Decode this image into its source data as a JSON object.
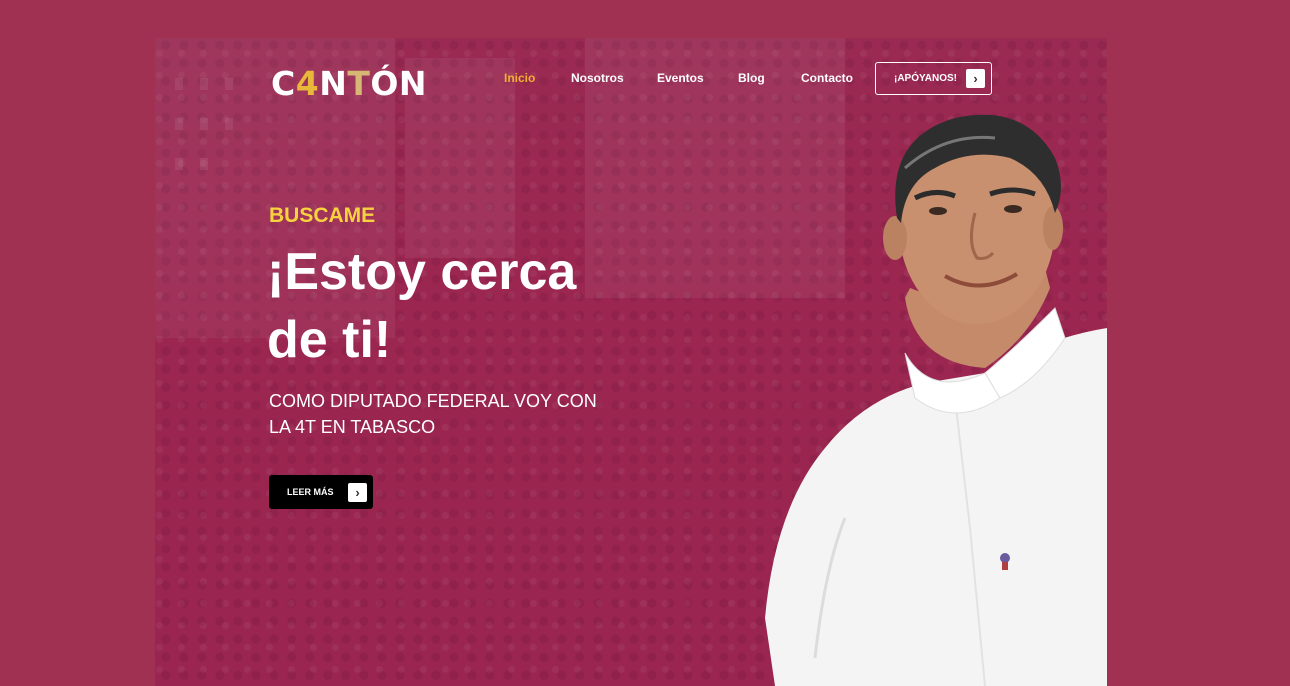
{
  "brand": {
    "logo_c": "C",
    "logo_4": "4",
    "logo_n": "N",
    "logo_t": "T",
    "logo_rest": "ÓN"
  },
  "nav": {
    "items": [
      {
        "label": "Inicio",
        "active": true
      },
      {
        "label": "Nosotros"
      },
      {
        "label": "Eventos"
      },
      {
        "label": "Blog"
      },
      {
        "label": "Contacto"
      }
    ],
    "cta_label": "¡APÓYANOS!"
  },
  "hero": {
    "kicker": "BUSCAME",
    "title_line1": "¡Estoy cerca",
    "title_line2": "de ti!",
    "subtitle": "COMO DIPUTADO FEDERAL VOY CON LA 4T EN TABASCO",
    "button_label": "LEER MÁS"
  },
  "icons": {
    "cta_arrow": "chevron-right-icon",
    "button_arrow": "chevron-right-icon"
  },
  "colors": {
    "page_bg": "#a03153",
    "accent_yellow": "#f7d23f",
    "nav_active": "#f0b030",
    "button_bg": "#000000"
  }
}
